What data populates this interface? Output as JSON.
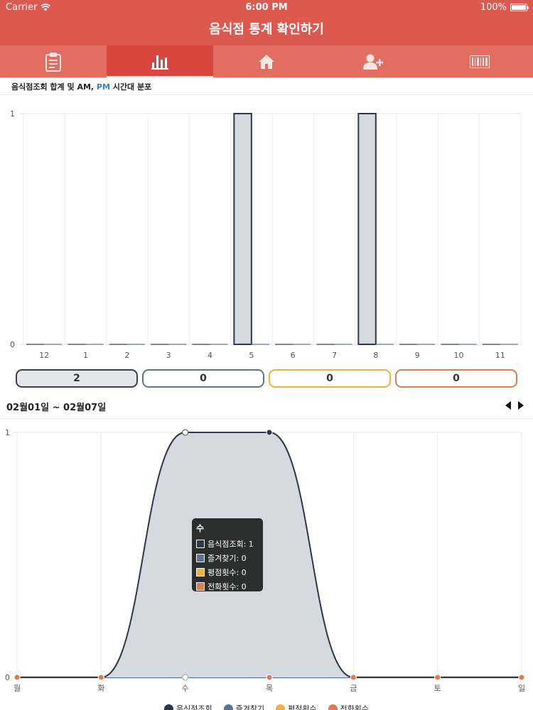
{
  "status": {
    "carrier": "Carrier",
    "time": "6:00 PM",
    "battery": "100%"
  },
  "nav": {
    "title": "음식점 통계 확인하기"
  },
  "tabs": [
    {
      "icon": "clipboard-icon",
      "active": false
    },
    {
      "icon": "bar-chart-icon",
      "active": true
    },
    {
      "icon": "home-icon",
      "active": false
    },
    {
      "icon": "add-user-icon",
      "active": false
    },
    {
      "icon": "barcode-icon",
      "active": false
    }
  ],
  "caption": {
    "prefix": "음식점조회 합계 및 AM, ",
    "pm": "PM",
    "suffix": " 시간대 분포"
  },
  "colors": {
    "primary": "#dc5950",
    "series1": "#2f3647",
    "series2": "#5a7491",
    "series3": "#f0b23c",
    "series4": "#e07a52"
  },
  "totals": [
    {
      "value": "2"
    },
    {
      "value": "0"
    },
    {
      "value": "0"
    },
    {
      "value": "0"
    }
  ],
  "range": {
    "label": "02월01일 ~ 02월07일"
  },
  "tooltip": {
    "title": "수",
    "rows": [
      {
        "label": "음식점조회: 1",
        "color": "#2f3647"
      },
      {
        "label": "즐겨찾기: 0",
        "color": "#5a7491"
      },
      {
        "label": "평점횟수: 0",
        "color": "#f0b23c"
      },
      {
        "label": "전화횟수: 0",
        "color": "#e07a52"
      }
    ]
  },
  "legend": [
    {
      "label": "음식점조회",
      "color": "#2f3647"
    },
    {
      "label": "즐겨찾기",
      "color": "#5a7491"
    },
    {
      "label": "평점횟수",
      "color": "#f0b23c"
    },
    {
      "label": "전화횟수",
      "color": "#e07a52"
    }
  ],
  "chart_data": [
    {
      "type": "bar",
      "categories": [
        "12",
        "1",
        "2",
        "3",
        "4",
        "5",
        "6",
        "7",
        "8",
        "9",
        "10",
        "11"
      ],
      "series": [
        {
          "values": [
            0,
            0,
            0,
            0,
            0,
            1,
            0,
            0,
            1,
            0,
            0,
            0
          ],
          "color": "#2f3647"
        },
        {
          "values": [
            0,
            0,
            0,
            0,
            0,
            0,
            0,
            0,
            0,
            0,
            0,
            0
          ],
          "color": "#5a7491"
        }
      ],
      "ylim": [
        0,
        1
      ],
      "yticks": [
        "0",
        "1"
      ],
      "grid": true
    },
    {
      "type": "area",
      "categories": [
        "월",
        "화",
        "수",
        "목",
        "금",
        "토",
        "일"
      ],
      "series": [
        {
          "name": "음식점조회",
          "values": [
            0,
            0,
            1,
            1,
            0,
            0,
            0
          ],
          "color": "#2f3647"
        },
        {
          "name": "즐겨찾기",
          "values": [
            0,
            0,
            0,
            0,
            0,
            0,
            0
          ],
          "color": "#5a7491"
        },
        {
          "name": "평점횟수",
          "values": [
            0,
            0,
            0,
            0,
            0,
            0,
            0
          ],
          "color": "#f0b23c"
        },
        {
          "name": "전화횟수",
          "values": [
            0,
            0,
            0,
            0,
            0,
            0,
            0
          ],
          "color": "#e07a52"
        }
      ],
      "ylim": [
        0,
        1
      ],
      "yticks": [
        "0",
        "1"
      ],
      "grid": true,
      "legend": "bottom"
    }
  ]
}
